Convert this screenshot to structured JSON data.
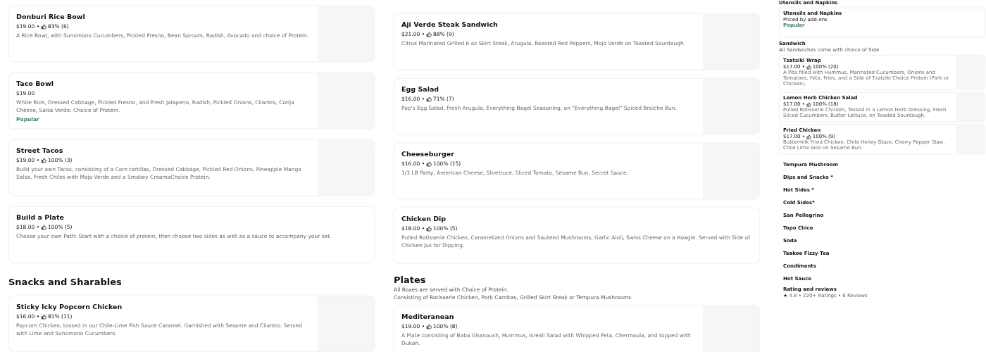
{
  "columns": [
    {
      "blocks": [
        {
          "kind": "item",
          "title": "Donburi Rice Bowl",
          "price": "$19.00 •",
          "rating": "83% (6)",
          "description": "A Rice Bowl, with Sunomono Cucumbers, Pickled Fresno, Bean Sprouts, Radish, Avocado and choice of Protein.",
          "image": true
        },
        {
          "kind": "item",
          "title": "Taco Bowl",
          "price": "$19.00",
          "description": "White Rice, Dressed Cabbage, Pickled Fresno, and Fresh Jalapeno, Radish, Pickled Onions, Cilantro, Cotija Cheese, Salsa Verde. Choice of Protein.",
          "badge": "Popular",
          "image": true
        },
        {
          "kind": "item",
          "title": "Street Tacos",
          "price": "$19.00 •",
          "rating": "100% (3)",
          "description": "Build your own Tacos, consisting of a Corn tortillas, Dressed Cabbage, Pickled Red Onions, Pineapple Mango Salsa, Fresh Chiles with Mojo Verde and a Smokey CreamaChoice Protein.",
          "image": true
        },
        {
          "kind": "item",
          "title": "Build a Plate",
          "price": "$18.00 •",
          "rating": "100% (5)",
          "description": "Choose your own Path: Start with a choice of protein, then choose two sides as well as a sauce to accompany your set.",
          "image": false
        },
        {
          "kind": "section",
          "title": "Snacks and Sharables"
        },
        {
          "kind": "item",
          "title": "Sticky Icky Popcorn Chicken",
          "price": "$16.00 •",
          "rating": "81% (11)",
          "description": "Popcorn Chicken, tossed in our Chile-Lime Fish Sauce Caramel. Garnished with Sesame and Cilantro. Served with Lime and Sunomono Cucumbers.",
          "image": true
        }
      ]
    },
    {
      "blocks": [
        {
          "kind": "item",
          "title": "Aji Verde Steak Sandwich",
          "price": "$21.00 •",
          "rating": "88% (9)",
          "description": "Citrus Marinated Grilled 6 oz Skirt Steak, Arugula, Roasted Red Peppers, Mojo Verde on Toasted Sourdough.",
          "image": true
        },
        {
          "kind": "item",
          "title": "Egg Salad",
          "price": "$16.00 •",
          "rating": "71% (7)",
          "description": "Pop's Egg Salad, Fresh Arugula, Everything Bagel Seasoning, on \"Everything Bagel\" Spiced Broiche Bun.",
          "image": true
        },
        {
          "kind": "item",
          "title": "Cheeseburger",
          "price": "$16.00 •",
          "rating": "100% (15)",
          "description": "1/3 LB Patty, American Cheese, Shrettuce, Sliced Tomato, Sesame Bun, Secret Sauce.",
          "image": true
        },
        {
          "kind": "item",
          "title": "Chicken Dip",
          "price": "$18.00 •",
          "rating": "100% (5)",
          "description": "Pulled Rotisserie Chicken, Caramelized Onions and Sauteed Mushrooms, Garlic Aioli, Swiss Cheese on a Hoagie. Served with Side of Chicken Jus for Dipping.",
          "image": false
        },
        {
          "kind": "section",
          "title": "Plates",
          "lines": [
            "All Boxes are served with Choice of Protein.",
            "Consisting of Rotisserie Chicken, Pork Carnitas, Grilled Skirt Steak or Tempura Mushrooms."
          ]
        },
        {
          "kind": "item",
          "title": "Mediteranean",
          "price": "$19.00 •",
          "rating": "100% (8)",
          "description": "A Plate consisting of Baba Ghanoush, Hummus, Isreali Salad with Whipped Feta, Chermoula, and topped with Dukah.",
          "image": true
        }
      ]
    },
    {
      "blocks": [
        {
          "kind": "section",
          "title": "Utensils and Napkins"
        },
        {
          "kind": "item",
          "title": "Utensils and Napkins",
          "price": "Priced by add-ons",
          "badge": "Popular",
          "image": false
        },
        {
          "kind": "section",
          "title": "Sandwich",
          "lines": [
            "All Sandwiches come with choice of Side."
          ]
        },
        {
          "kind": "item",
          "title": "Tzatziki Wrap",
          "price": "$17.00 •",
          "rating": "100% (20)",
          "description": "A Pita filled with Hummus, Marinated Cucumbers, Onions and Tomatoes, Feta, Fries, and a Side of Tzatziki Choice Protein (Pork or Chicken).",
          "image": true
        },
        {
          "kind": "item",
          "title": "Lemon Herb Chicken Salad",
          "price": "$17.00 •",
          "rating": "100% (18)",
          "description": "Pulled Rotisserie Chicken, Tossed in a Lemon Herb Dressing, Fresh Sliced Cucumbers, Butter Lettuce, on Toasted Sourdough.",
          "image": true
        },
        {
          "kind": "item",
          "title": "Fried Chicken",
          "price": "$17.00 •",
          "rating": "100% (9)",
          "description": "Buttermilk Fried Chicken, Chile Honey Glaze, Cherry Pepper Slaw, Chile Lime Aioli on Sesame Bun.",
          "image": true
        },
        {
          "kind": "link",
          "title": "Tempura Mushroom"
        },
        {
          "kind": "link",
          "title": "Dips and Snacks *"
        },
        {
          "kind": "link",
          "title": "Hot Sides *"
        },
        {
          "kind": "link",
          "title": "Cold Sides*"
        },
        {
          "kind": "link",
          "title": "San Pellegrino"
        },
        {
          "kind": "link",
          "title": "Topo Chico"
        },
        {
          "kind": "link",
          "title": "Soda"
        },
        {
          "kind": "link",
          "title": "Teakoe Fizzy Tea"
        },
        {
          "kind": "link",
          "title": "Condiments"
        },
        {
          "kind": "link",
          "title": "Hot Sauce"
        },
        {
          "kind": "rating",
          "title": "Rating and reviews",
          "star": "★",
          "summary": "4.8 • 220+ Ratings • 6 Reviews"
        }
      ]
    }
  ]
}
